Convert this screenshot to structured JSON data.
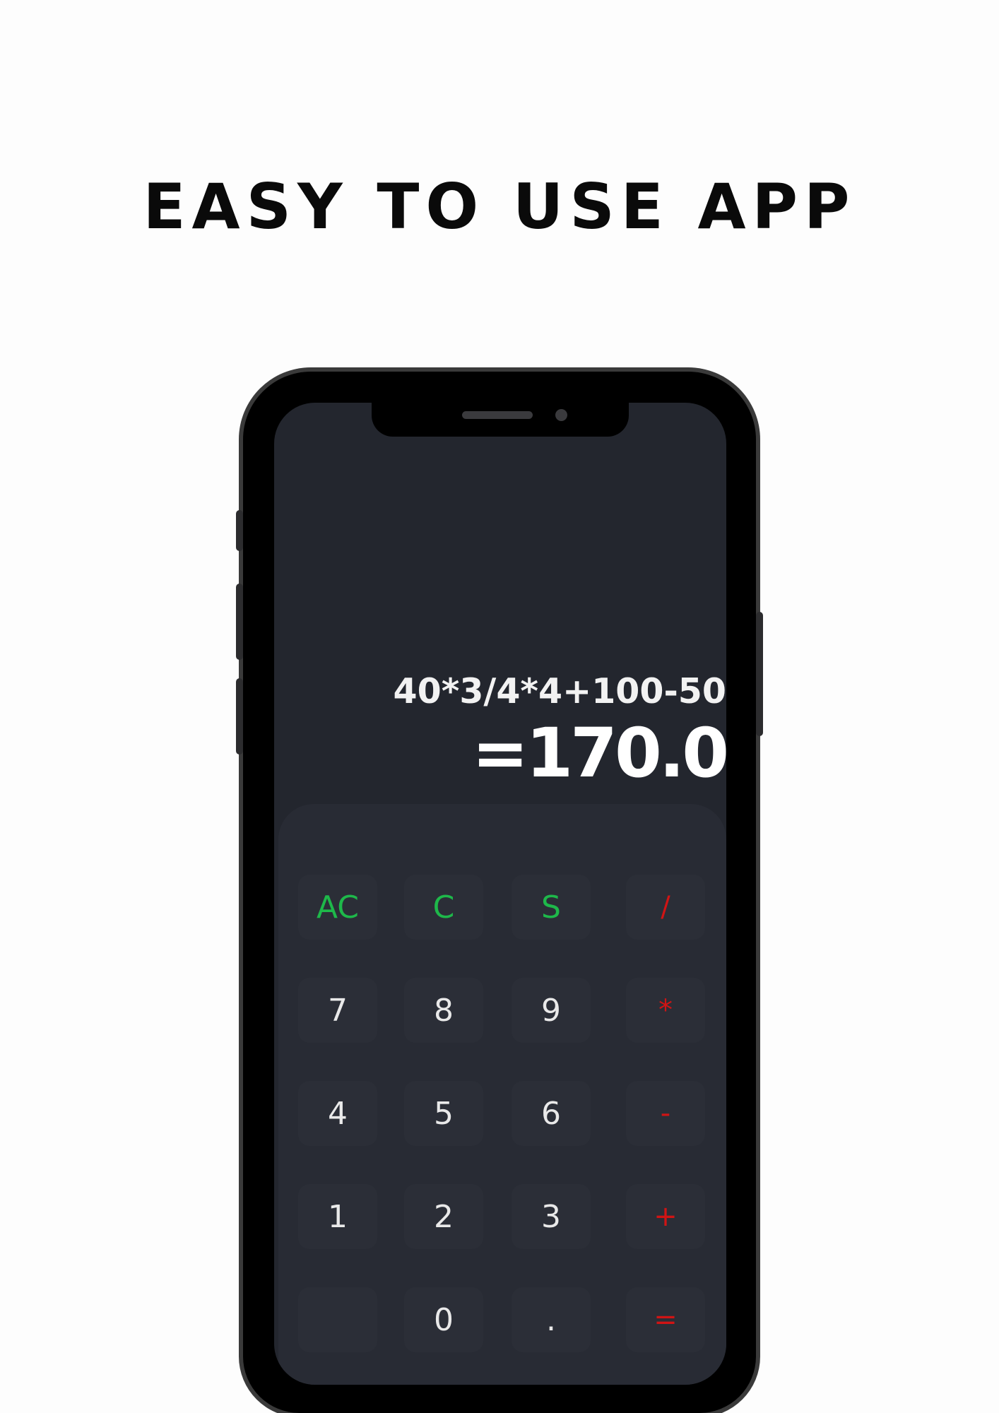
{
  "headline": "EASY TO USE APP",
  "display": {
    "expression": "40*3/4*4+100-50",
    "result": "=170.0"
  },
  "keys": [
    {
      "label": "AC",
      "kind": "fn"
    },
    {
      "label": "C",
      "kind": "fn"
    },
    {
      "label": "S",
      "kind": "fn"
    },
    {
      "label": "/",
      "kind": "op"
    },
    {
      "label": "7",
      "kind": "num"
    },
    {
      "label": "8",
      "kind": "num"
    },
    {
      "label": "9",
      "kind": "num"
    },
    {
      "label": "*",
      "kind": "op"
    },
    {
      "label": "4",
      "kind": "num"
    },
    {
      "label": "5",
      "kind": "num"
    },
    {
      "label": "6",
      "kind": "num"
    },
    {
      "label": "-",
      "kind": "op"
    },
    {
      "label": "1",
      "kind": "num"
    },
    {
      "label": "2",
      "kind": "num"
    },
    {
      "label": "3",
      "kind": "num"
    },
    {
      "label": "+",
      "kind": "op"
    },
    {
      "label": "",
      "kind": "num"
    },
    {
      "label": "0",
      "kind": "num"
    },
    {
      "label": ".",
      "kind": "num"
    },
    {
      "label": "=",
      "kind": "op"
    }
  ],
  "colors": {
    "function_key": "#1eb84a",
    "operator_key": "#d01414",
    "screen_background": "#23262e"
  }
}
